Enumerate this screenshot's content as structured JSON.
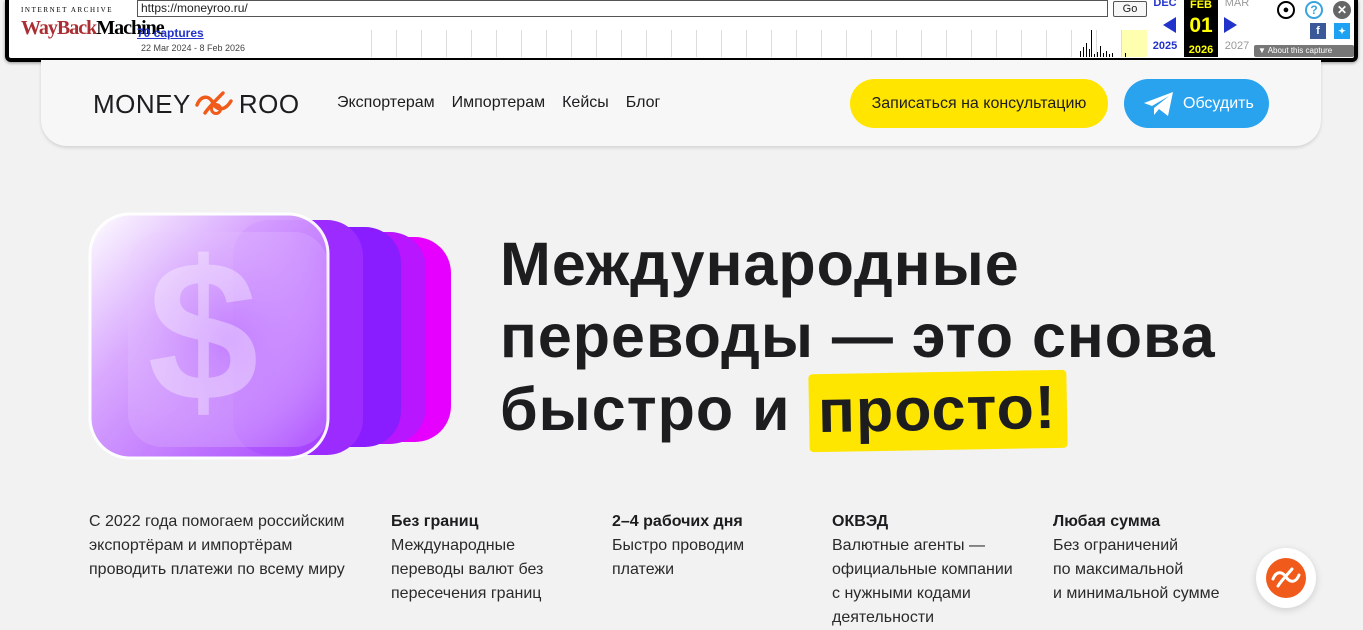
{
  "wayback": {
    "logo_top": "INTERNET ARCHIVE",
    "logo_wayback": "WayBack",
    "logo_machine": "Machine",
    "url": "https://moneyroo.ru/",
    "go_label": "Go",
    "captures_label": "70 captures",
    "date_range": "22 Mar 2024 - 8 Feb 2026",
    "prev_month": "DEC",
    "prev_year": "2025",
    "cur_month": "FEB",
    "cur_day": "01",
    "cur_year": "2026",
    "next_month": "MAR",
    "next_year": "2027",
    "about_label": "About this capture"
  },
  "header": {
    "logo_left": "MONEY",
    "logo_right": "ROO",
    "nav": [
      "Экспортерам",
      "Импортерам",
      "Кейсы",
      "Блог"
    ],
    "consult_button": "Записаться на консультацию",
    "discuss_button": "Обсудить"
  },
  "hero": {
    "line1": "Международные",
    "line2": "переводы — это снова",
    "line3_start": "быстро и ",
    "line3_highlight": "просто!"
  },
  "features": [
    {
      "title": "",
      "lines": [
        "С 2022 года помогаем российским",
        "экспортёрам и импортёрам",
        "проводить платежи по всему миру"
      ]
    },
    {
      "title": "Без границ",
      "lines": [
        "Международные",
        "переводы валют без",
        "пересечения границ"
      ]
    },
    {
      "title": "2–4 рабочих дня",
      "lines": [
        "Быстро проводим",
        "платежи"
      ]
    },
    {
      "title": "ОКВЭД",
      "lines": [
        "Валютные агенты —",
        "официальные компании",
        "с нужными кодами",
        "деятельности"
      ]
    },
    {
      "title": "Любая сумма",
      "lines": [
        "Без ограничений",
        "по максимальной",
        "и минимальной сумме"
      ]
    }
  ],
  "colors": {
    "accent_yellow": "#ffe500",
    "telegram_blue": "#2aa3ef",
    "brand_orange": "#f05a1a",
    "purple": "#b44dff"
  }
}
